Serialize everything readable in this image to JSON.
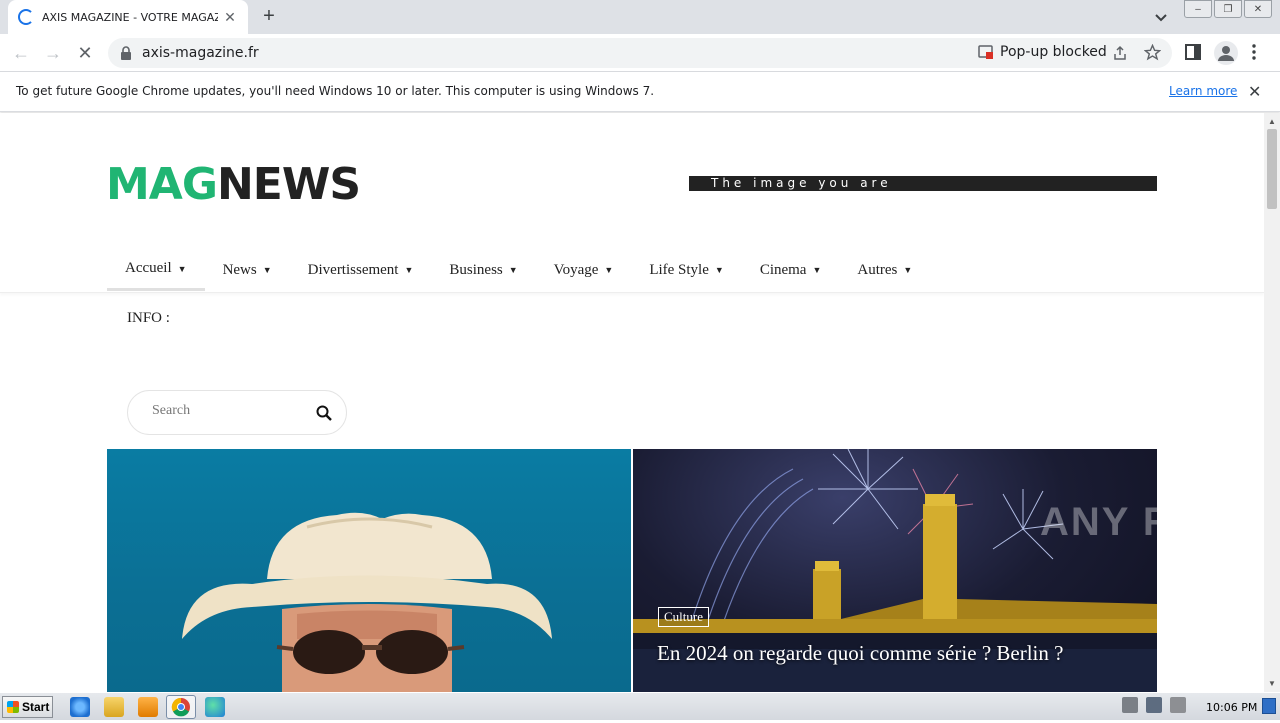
{
  "browser": {
    "tab_title": "AXIS MAGAZINE - VOTRE MAGAZINE",
    "url": "axis-magazine.fr",
    "popup_blocked": "Pop-up blocked",
    "infobar_message": "To get future Google Chrome updates, you'll need Windows 10 or later. This computer is using Windows 7.",
    "infobar_link": "Learn more"
  },
  "site": {
    "logo_part1": "MAG",
    "logo_part2": "NEWS",
    "logo_colors": {
      "mag": "#20b573",
      "news": "#222222"
    },
    "banner_text": "The image you are",
    "nav": [
      {
        "label": "Accueil",
        "active": true
      },
      {
        "label": "News"
      },
      {
        "label": "Divertissement"
      },
      {
        "label": "Business"
      },
      {
        "label": "Voyage"
      },
      {
        "label": "Life Style"
      },
      {
        "label": "Cinema"
      },
      {
        "label": "Autres"
      }
    ],
    "info_label": "INFO :",
    "search_placeholder": "Search",
    "featured": {
      "right_tag": "Culture",
      "right_headline": "En 2024 on regarde quoi comme série ? Berlin ?"
    }
  },
  "watermark": "ANY RUN",
  "taskbar": {
    "start_label": "Start",
    "clock": "10:06 PM"
  }
}
